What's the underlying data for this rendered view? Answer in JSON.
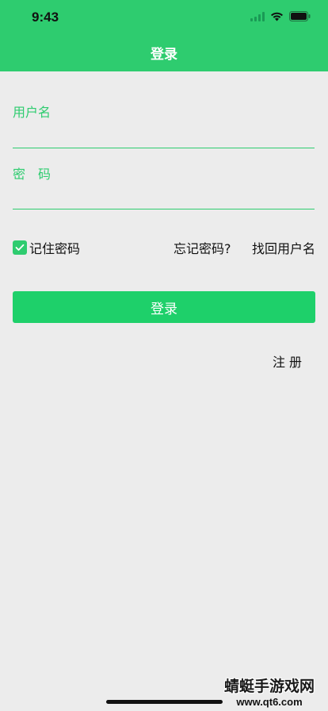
{
  "status_bar": {
    "time": "9:43"
  },
  "nav": {
    "title": "登录"
  },
  "form": {
    "username": {
      "label": "用户名",
      "value": ""
    },
    "password": {
      "label": "密　码",
      "value": ""
    },
    "remember_label": "记住密码",
    "remember_checked": true,
    "forgot_password": "忘记密码?",
    "recover_username": "找回用户名",
    "login_button": "登录",
    "register": "注册"
  },
  "watermark": {
    "title": "蜻蜓手游戏网",
    "url": "www.qt6.com"
  },
  "colors": {
    "accent": "#2ecc6f",
    "button": "#1ed06a",
    "background": "#ececec"
  }
}
